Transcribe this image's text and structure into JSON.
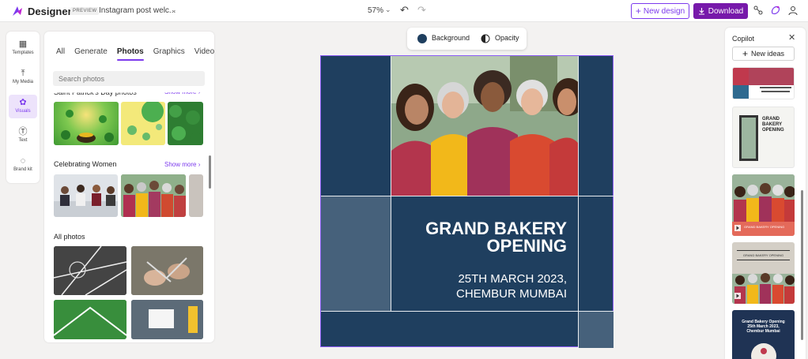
{
  "app": {
    "brand": "Designer",
    "badge": "PREVIEW",
    "document_title": "Instagram post welc...",
    "zoom": "57%"
  },
  "toolbar": {
    "new_design_label": "New design",
    "download_label": "Download"
  },
  "rail": {
    "items": [
      {
        "label": "Templates",
        "icon": "templates-icon"
      },
      {
        "label": "My Media",
        "icon": "upload-icon"
      },
      {
        "label": "Visuals",
        "icon": "visuals-icon",
        "active": true
      },
      {
        "label": "Text",
        "icon": "text-icon"
      },
      {
        "label": "Brand kit",
        "icon": "brand-kit-icon"
      }
    ]
  },
  "panel": {
    "tabs": [
      "All",
      "Generate",
      "Photos",
      "Graphics",
      "Videos"
    ],
    "active_tab": "Photos",
    "search_placeholder": "Search photos",
    "sections": [
      {
        "title": "Saint Patrick's Day photos",
        "show_more": "Show more"
      },
      {
        "title": "Celebrating Women",
        "show_more": "Show more"
      },
      {
        "title": "All photos"
      }
    ]
  },
  "canvas_toolbar": {
    "background_label": "Background",
    "opacity_label": "Opacity",
    "background_color": "#1f3f5f"
  },
  "design": {
    "headline_line1": "GRAND BAKERY",
    "headline_line2": "OPENING",
    "date_line": "25TH MARCH 2023,",
    "location_line": "CHEMBUR MUMBAI"
  },
  "copilot": {
    "title": "Copilot",
    "new_ideas_label": "New ideas",
    "ideas": [
      {
        "text1": "GRAND",
        "text2": "BAKERY",
        "text3": "OPENING"
      },
      {
        "text": "GRAND BAKERY OPENING"
      },
      {
        "text": "GRAND BAKERY OPENING"
      },
      {
        "text1": "Grand Bakery Opening",
        "text2": "25th March 2023,",
        "text3": "Chembur Mumbai"
      }
    ]
  },
  "colors": {
    "accent": "#7c3aed",
    "download": "#7719aa",
    "navy": "#1f3f5f"
  }
}
